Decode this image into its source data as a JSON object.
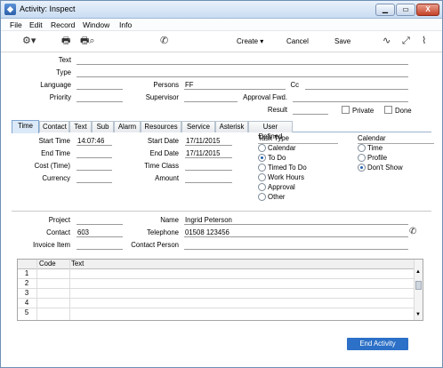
{
  "window": {
    "title": "Activity: Inspect",
    "app_icon": "app-icon",
    "buttons": [
      "minimize",
      "maximize",
      "close"
    ],
    "close_glyph": "X"
  },
  "menu": [
    "File",
    "Edit",
    "Record",
    "Window",
    "Info"
  ],
  "toolbar": {
    "settings_icon": "gear-icon",
    "print_icon": "print-icon",
    "preview_icon": "print-preview-icon",
    "phone_icon": "phone-icon",
    "create_label": "Create",
    "cancel_label": "Cancel",
    "save_label": "Save",
    "status_icon": "chart-line-icon",
    "expand_icon": "expand-icon",
    "attach_icon": "paperclip-icon"
  },
  "header": {
    "text_label": "Text",
    "text_value": "",
    "type_label": "Type",
    "type_value": "",
    "language_label": "Language",
    "language_value": "",
    "persons_label": "Persons",
    "persons_value": "FF",
    "cc_label": "Cc",
    "cc_value": "",
    "priority_label": "Priority",
    "priority_value": "",
    "supervisor_label": "Supervisor",
    "supervisor_value": "",
    "approval_label": "Approval Fwd.",
    "approval_value": "",
    "result_label": "Result",
    "result_value": "",
    "private_label": "Private",
    "private_checked": false,
    "done_label": "Done",
    "done_checked": false
  },
  "tabs": [
    "Time",
    "Contact",
    "Text",
    "Sub",
    "Alarm",
    "Resources",
    "Service",
    "Asterisk",
    "User Defined"
  ],
  "active_tab": "Time",
  "time": {
    "start_time_label": "Start Time",
    "start_time_value": "14:07:46",
    "end_time_label": "End Time",
    "end_time_value": "",
    "cost_label": "Cost (Time)",
    "cost_value": "",
    "currency_label": "Currency",
    "currency_value": "",
    "start_date_label": "Start Date",
    "start_date_value": "17/11/2015",
    "end_date_label": "End Date",
    "end_date_value": "17/11/2015",
    "time_class_label": "Time Class",
    "time_class_value": "",
    "amount_label": "Amount",
    "amount_value": ""
  },
  "task_type": {
    "title": "Task Type",
    "options": [
      "Calendar",
      "To Do",
      "Timed To Do",
      "Work Hours",
      "Approval",
      "Other"
    ],
    "selected": "To Do"
  },
  "calendar": {
    "title": "Calendar",
    "options": [
      "Time",
      "Profile",
      "Don't Show"
    ],
    "selected": "Don't Show"
  },
  "contact": {
    "project_label": "Project",
    "project_value": "",
    "contact_label": "Contact",
    "contact_value": "603",
    "invoice_label": "Invoice Item",
    "invoice_value": "",
    "name_label": "Name",
    "name_value": "Ingrid Peterson",
    "telephone_label": "Telephone",
    "telephone_value": "01508 123456",
    "contact_person_label": "Contact Person",
    "contact_person_value": "",
    "call_icon": "phone-icon"
  },
  "grid": {
    "columns": [
      "Code",
      "Text"
    ],
    "rows": [
      {
        "num": "1",
        "code": "",
        "text": ""
      },
      {
        "num": "2",
        "code": "",
        "text": ""
      },
      {
        "num": "3",
        "code": "",
        "text": ""
      },
      {
        "num": "4",
        "code": "",
        "text": ""
      },
      {
        "num": "5",
        "code": "",
        "text": ""
      }
    ]
  },
  "end_activity_label": "End Activity",
  "colors": {
    "accent": "#2c70c7",
    "tab_active": "#dbe9f8",
    "title_bar": "#c9dcf2"
  }
}
